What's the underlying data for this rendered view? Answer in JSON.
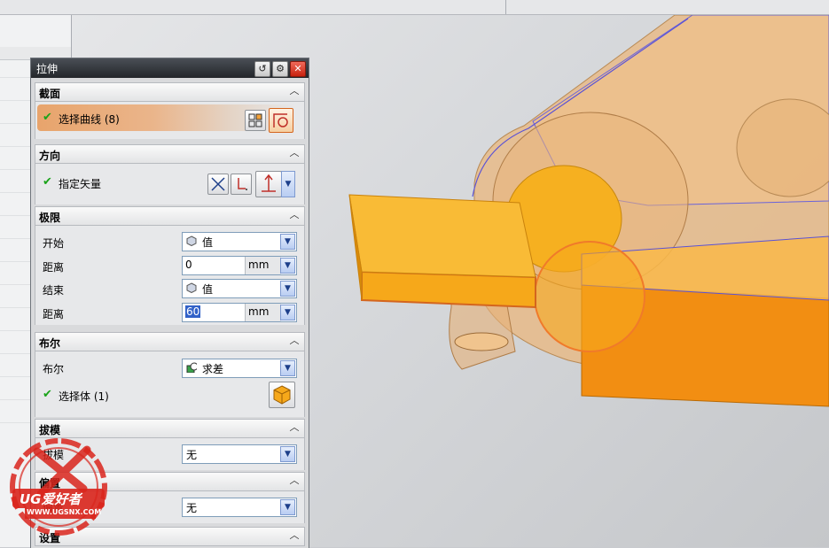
{
  "dialog": {
    "title": "拉伸",
    "sections": {
      "section": {
        "label": "截面",
        "select_curve_label": "选择曲线 (8)"
      },
      "direction": {
        "label": "方向",
        "specify_vector_label": "指定矢量"
      },
      "limits": {
        "label": "极限",
        "start_label": "开始",
        "start_value": "值",
        "start_distance_label": "距离",
        "start_distance_value": "0",
        "start_unit": "mm",
        "end_label": "结束",
        "end_value": "值",
        "end_distance_label": "距离",
        "end_distance_value": "60",
        "end_unit": "mm"
      },
      "boolean": {
        "label": "布尔",
        "boolean_label": "布尔",
        "boolean_value": "求差",
        "select_body_label": "选择体 (1)"
      },
      "draft": {
        "label": "拔模",
        "draft_label": "拔模",
        "draft_value": "无"
      },
      "offset": {
        "label": "偏置",
        "offset_label": "偏置",
        "offset_value": "无"
      },
      "settings": {
        "label": "设置"
      }
    }
  },
  "watermark": {
    "brand": "UG爱好者",
    "url": "WWW.UGSNX.COM"
  },
  "colors": {
    "model_orange": "#f5a623",
    "model_dark_orange": "#e88a0c",
    "checkmark_green": "#1aa31a",
    "selection_blue": "#3161c8",
    "title_bar": "#2b2f34",
    "watermark_red": "#d9251c"
  }
}
